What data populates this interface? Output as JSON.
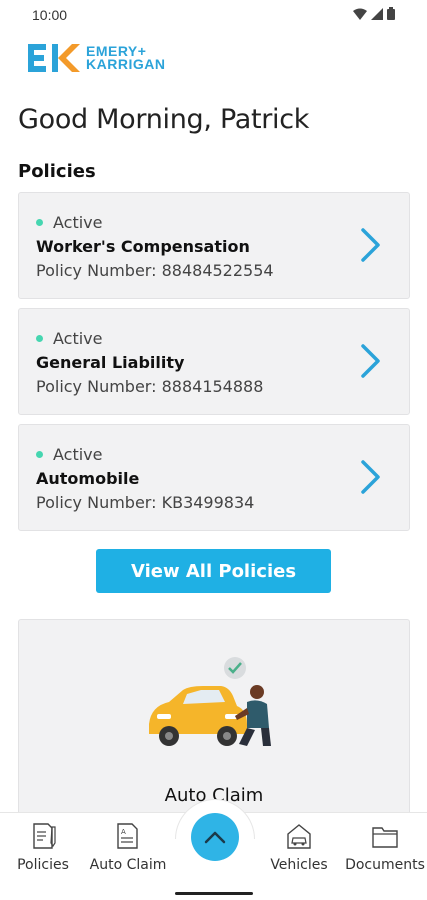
{
  "status_bar": {
    "time": "10:00"
  },
  "brand": {
    "line1": "EMERY+",
    "line2": "KARRIGAN",
    "primary_color": "#2ba3d9",
    "accent_color": "#f39a2a"
  },
  "greeting": "Good Morning, Patrick",
  "policies_section": {
    "title": "Policies",
    "items": [
      {
        "status": "Active",
        "name": "Worker's Compensation",
        "number_label": "Policy Number:",
        "number": "88484522554"
      },
      {
        "status": "Active",
        "name": "General Liability",
        "number_label": "Policy Number:",
        "number": "8884154888"
      },
      {
        "status": "Active",
        "name": "Automobile",
        "number_label": "Policy Number:",
        "number": "KB3499834"
      }
    ],
    "view_all_label": "View All Policies"
  },
  "claim_card": {
    "label": "Auto Claim"
  },
  "bottom_nav": {
    "items": [
      {
        "label": "Policies",
        "icon": "policies-icon"
      },
      {
        "label": "Auto Claim",
        "icon": "auto-claim-icon"
      },
      {
        "label": "Vehicles",
        "icon": "vehicles-icon"
      },
      {
        "label": "Documents",
        "icon": "documents-icon"
      }
    ],
    "fab_icon": "chevron-up-icon"
  },
  "colors": {
    "active_dot": "#46d6b0",
    "button": "#1fb0e4",
    "chevron": "#2ba3d9"
  }
}
